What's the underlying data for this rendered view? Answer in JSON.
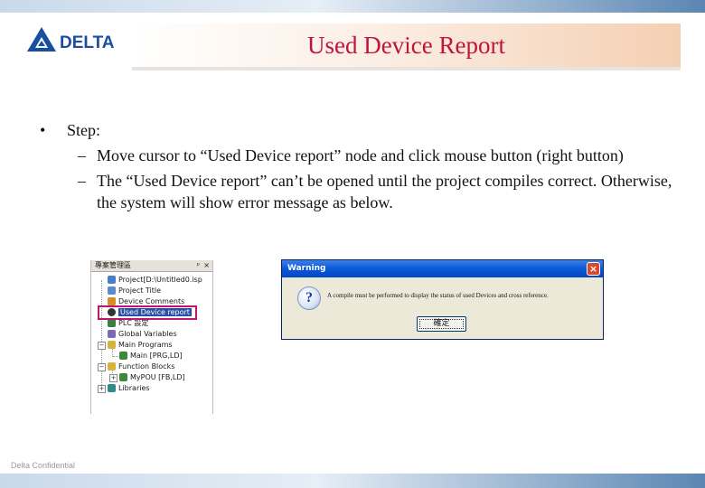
{
  "header": {
    "logo_text": "DELTA",
    "title": "Used Device Report"
  },
  "body": {
    "bullet": "•",
    "step_label": "Step:",
    "dash": "–",
    "items": [
      {
        "text": "Move cursor to “Used Device report” node and click mouse button (right button)"
      },
      {
        "text": "The “Used Device report” can’t be opened until the project compiles correct. Otherwise, the system will show error message as below."
      }
    ]
  },
  "tree": {
    "header_title": "專案管理區",
    "pin_glyph": "ᵖ",
    "close_glyph": "×",
    "nodes": [
      {
        "label": "Project[D:\\Untitled0.isp",
        "icon": "project-icon",
        "color": "#4a7cc8"
      },
      {
        "label": "Project Title",
        "icon": "document-icon",
        "color": "#5c88d0"
      },
      {
        "label": "Device Comments",
        "icon": "comments-icon",
        "color": "#d98a2a"
      },
      {
        "label": "Used Device report",
        "icon": "report-icon",
        "color": "#333333"
      },
      {
        "label": "PLC 設定",
        "icon": "plc-icon",
        "color": "#3b7f3b"
      },
      {
        "label": "Global Variables",
        "icon": "variables-icon",
        "color": "#7a6ab8"
      },
      {
        "label": "Main Programs",
        "icon": "folder-icon",
        "color": "#d6b33a"
      },
      {
        "label": "Main [PRG,LD]",
        "icon": "program-icon",
        "color": "#3a8a3a"
      },
      {
        "label": "Function Blocks",
        "icon": "folder-icon",
        "color": "#d6b33a"
      },
      {
        "label": "MyPOU [FB,LD]",
        "icon": "function-block-icon",
        "color": "#3a8a3a"
      },
      {
        "label": "Libraries",
        "icon": "library-icon",
        "color": "#2f8a8a"
      }
    ]
  },
  "dialog": {
    "title": "Warning",
    "close_glyph": "×",
    "icon_glyph": "?",
    "message": "A compile must be performed to display the status of used Devices and cross reference.",
    "ok_label": "確定"
  },
  "footer": {
    "text": "Delta Confidential"
  },
  "colors": {
    "title_red": "#c0143c",
    "highlight_magenta": "#c0156e",
    "dialog_blue": "#0a58d8"
  }
}
